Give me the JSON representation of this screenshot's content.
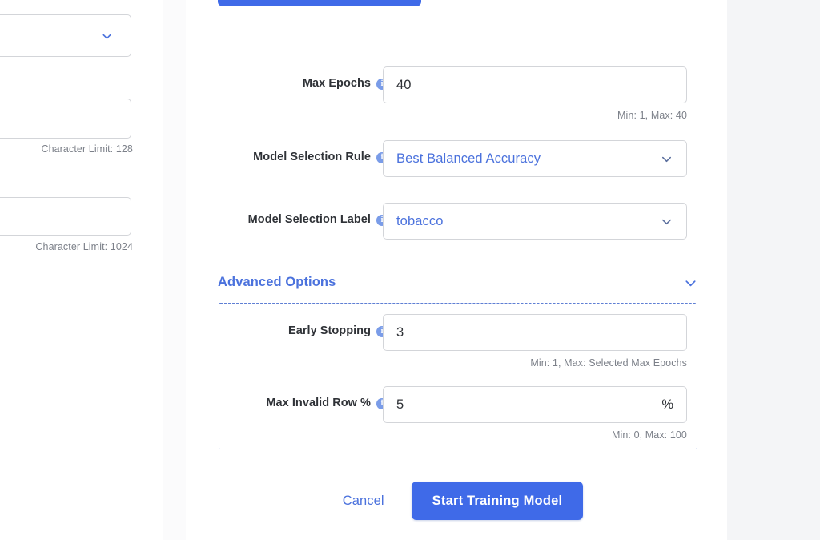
{
  "background_page": {
    "dropdown": {
      "value": "",
      "icon": "chevron-down-icon"
    },
    "name_field": {
      "value": "",
      "hint": "Character Limit: 128"
    },
    "description_field": {
      "value": "",
      "hint": "Character Limit: 1024"
    }
  },
  "modal": {
    "top_cut_button": {
      "label": ""
    },
    "fields": [
      {
        "key": "max_epochs",
        "label": "Max Epochs",
        "info_icon": "info-icon",
        "type": "text",
        "value": "40",
        "hint": "Min: 1, Max: 40"
      },
      {
        "key": "model_selection_rule",
        "label": "Model Selection Rule",
        "info_icon": "info-icon",
        "type": "select",
        "value": "Best Balanced Accuracy",
        "icon": "chevron-down-icon",
        "hint": ""
      },
      {
        "key": "model_selection_label",
        "label": "Model Selection Label",
        "info_icon": "info-icon",
        "type": "select",
        "value": "tobacco",
        "icon": "chevron-down-icon",
        "hint": ""
      }
    ],
    "advanced_options": {
      "title": "Advanced Options",
      "toggle_icon": "chevron-down-icon",
      "expanded": true,
      "fields": [
        {
          "key": "early_stopping",
          "label": "Early Stopping",
          "info_icon": "info-icon",
          "type": "text",
          "value": "3",
          "hint": "Min: 1, Max: Selected Max Epochs"
        },
        {
          "key": "max_invalid_row_pct",
          "label": "Max Invalid Row %",
          "info_icon": "info-icon",
          "type": "text",
          "value": "5",
          "suffix": "%",
          "hint": "Min: 0, Max: 100"
        }
      ]
    },
    "footer": {
      "cancel_label": "Cancel",
      "submit_label": "Start Training Model"
    }
  },
  "colors": {
    "primary_blue": "#3f6ae8",
    "link_blue": "#4b72dd",
    "info_badge": "#7a9ce8",
    "border_gray": "#d3d5d9",
    "hint_gray": "#7c8089",
    "page_bg": "#f4f5f7",
    "dashed_border": "#5f7fd4"
  }
}
